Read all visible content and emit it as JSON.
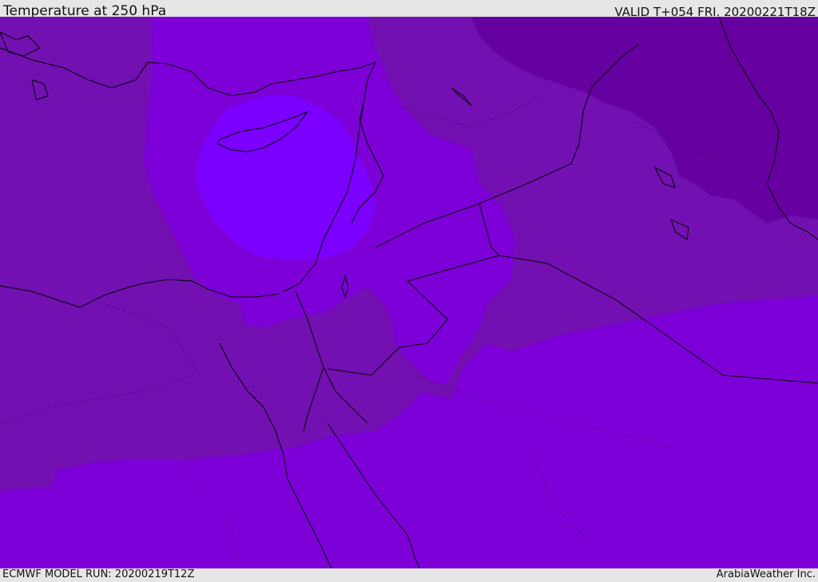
{
  "header": {
    "title": "Temperature at 250 hPa",
    "valid": "VALID T+054 FRI. 20200221T18Z"
  },
  "footer": {
    "model_run": "ECMWF MODEL RUN: 20200219T12Z",
    "credit": "ArabiaWeather Inc."
  },
  "map": {
    "colors": {
      "coldest": "#6600a0",
      "cold": "#7210b2",
      "mid": "#7d00d8",
      "warm": "#7b00ff",
      "coastline": "#000000"
    }
  }
}
